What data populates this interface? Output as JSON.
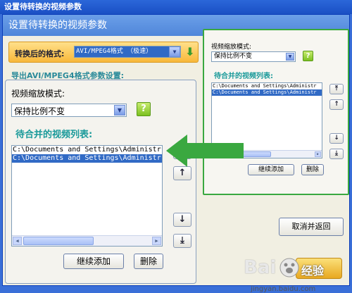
{
  "window": {
    "title": "设置待转换的视频参数"
  },
  "header": {
    "title": "设置待转换的视频参数"
  },
  "format": {
    "label": "转换后的格式:",
    "selected": "AVI/MPEG4格式 （极速）"
  },
  "subtitle": "导出AVI/MPEG4格式参数设置:",
  "main": {
    "mode_label": "视频缩放模式:",
    "mode_value": "保持比例不变",
    "help": "?",
    "list_title": "待合并的视频列表:",
    "list_items": [
      "C:\\Documents and Settings\\Administr",
      "C:\\Documents and Settings\\Administr"
    ],
    "add_button": "继续添加",
    "delete_button": "删除"
  },
  "preview": {
    "mode_label": "视频缩放模式:",
    "mode_value": "保持比例不变",
    "help": "?",
    "list_title": "待合并的视频列表:",
    "list_items": [
      "C:\\Documents and Settings\\Administr",
      "C:\\Documents and Settings\\Administr"
    ],
    "add_button": "继续添加",
    "delete_button": "删除"
  },
  "side_buttons": {
    "top": "⤒",
    "up": "↑",
    "down": "↓",
    "bottom": "⤓"
  },
  "cancel_button": "取消并返回",
  "watermark": {
    "brand": "Bai",
    "brand2": "经验",
    "url": "jingyan.baidu.com"
  },
  "colors": {
    "accent_green": "#3aa840",
    "selection": "#316ac5",
    "title_blue": "#1a4fc4",
    "orange": "#f8b83a"
  }
}
